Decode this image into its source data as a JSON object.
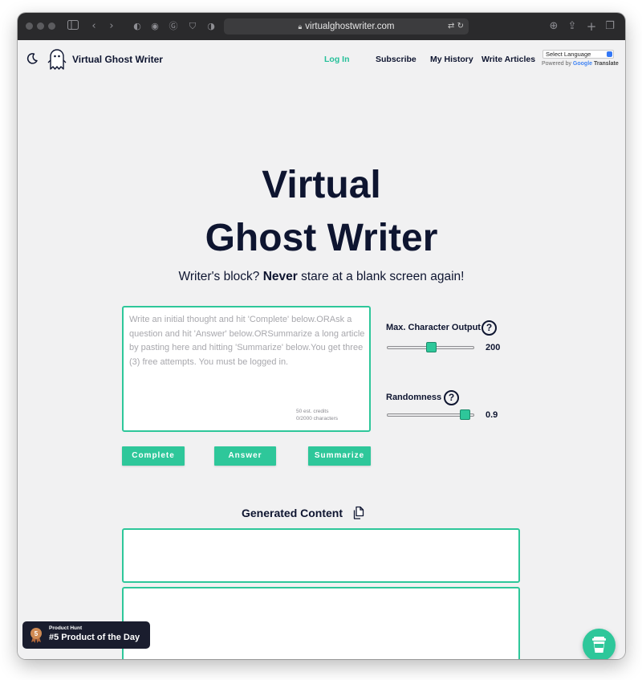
{
  "browser": {
    "url": "virtualghostwriter.com"
  },
  "header": {
    "brand": "Virtual Ghost Writer",
    "nav": {
      "login": "Log In",
      "subscribe": "Subscribe",
      "history": "My History",
      "articles": "Write Articles"
    },
    "language_select": "Select Language",
    "powered_by": "Powered by",
    "google": "Google",
    "translate": "Translate"
  },
  "hero": {
    "title_line1": "Virtual",
    "title_line2": "Ghost Writer",
    "tagline_before": "Writer's block? ",
    "tagline_bold": "Never",
    "tagline_after": " stare at a blank screen again!"
  },
  "prompt": {
    "placeholder": "Write an initial thought and hit 'Complete' below.ORAsk a question and hit 'Answer' below.ORSummarize a long article by pasting here and hitting 'Summarize' below.You get three (3) free attempts. You must be logged in.",
    "credits": "50 est. credits",
    "char_count": "0/2000 characters"
  },
  "buttons": {
    "complete": "Complete",
    "answer": "Answer",
    "summarize": "Summarize"
  },
  "controls": {
    "max_chars_label": "Max. Character Output",
    "max_chars_value": "200",
    "max_chars_fraction": 0.5,
    "randomness_label": "Randomness",
    "randomness_value": "0.9",
    "randomness_fraction": 0.9,
    "help_glyph": "?"
  },
  "output": {
    "title": "Generated Content"
  },
  "producthunt": {
    "small": "Product Hunt",
    "big": "#5 Product of the Day",
    "rank": "5"
  },
  "colors": {
    "accent": "#2ec79a",
    "navy": "#0e1530",
    "page_bg": "#f1f1f2"
  }
}
